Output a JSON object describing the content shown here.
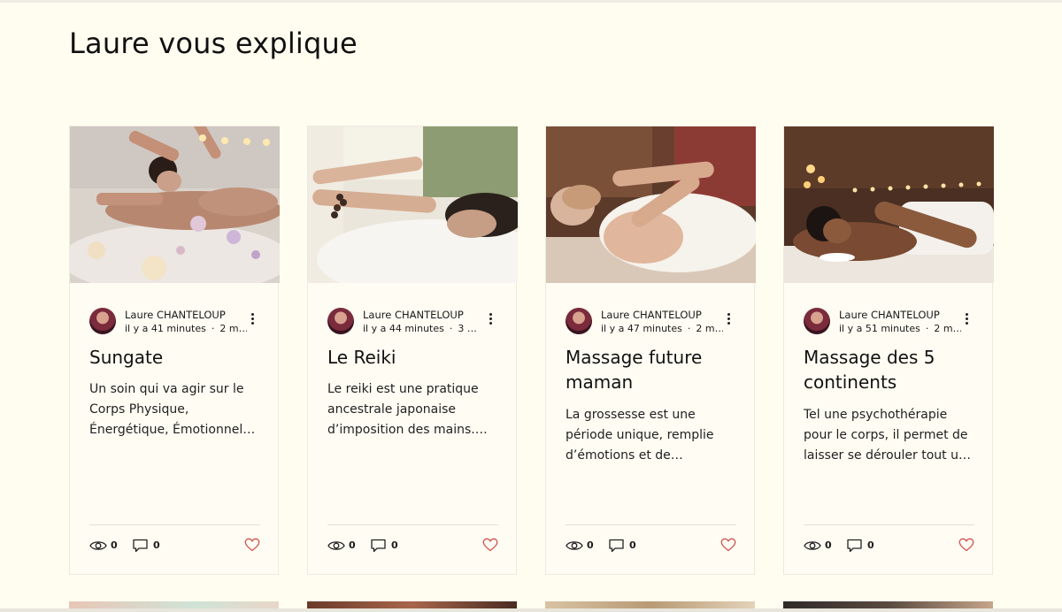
{
  "section_title": "Laure vous explique",
  "posts": [
    {
      "author": "Laure CHANTELOUP",
      "time": "il y a 41 minutes",
      "read": "2 m…",
      "title": "Sungate",
      "excerpt": "Un soin qui va agir sur le Corps Physique, Énergétique, Émotionnel…",
      "views": "0",
      "comments": "0",
      "image": "massage-with-candles-and-crystals"
    },
    {
      "author": "Laure CHANTELOUP",
      "time": "il y a 44 minutes",
      "read": "3 …",
      "title": "Le Reiki",
      "excerpt": "Le reiki est une pratique ancestrale japonaise d’imposition des mains.…",
      "views": "0",
      "comments": "0",
      "image": "reiki-hands-over-client"
    },
    {
      "author": "Laure CHANTELOUP",
      "time": "il y a 47 minutes",
      "read": "2 m…",
      "title": "Massage future maman",
      "excerpt": "La grossesse est une période unique, remplie d’émotions et de…",
      "views": "0",
      "comments": "0",
      "image": "pregnancy-massage"
    },
    {
      "author": "Laure CHANTELOUP",
      "time": "il y a 51 minutes",
      "read": "2 m…",
      "title": "Massage des 5 continents",
      "excerpt": "Tel une psychothérapie pour le corps, il permet de laisser se dérouler tout u…",
      "views": "0",
      "comments": "0",
      "image": "relaxing-client-candles"
    }
  ],
  "colors": {
    "background": "#fffdf0",
    "card": "#fffdf3",
    "heart": "#d0504f",
    "text": "#111111"
  },
  "icons": {
    "views": "eye-icon",
    "comments": "comment-icon",
    "like": "heart-icon",
    "menu": "more-vertical-icon"
  }
}
